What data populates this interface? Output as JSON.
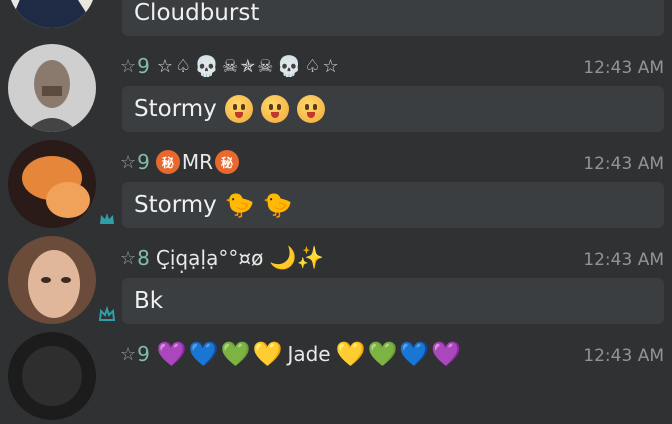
{
  "messages": [
    {
      "message": "Cloudburst"
    },
    {
      "level": "9",
      "username_symbols": [
        "☆",
        "♤",
        "💀",
        "☠",
        "✯",
        "☠",
        "💀",
        "♤",
        "☆"
      ],
      "time": "12:43 AM",
      "message": "Stormy",
      "message_emoji": [
        "😛",
        "😛",
        "😛"
      ]
    },
    {
      "level": "9",
      "username": "MR",
      "username_badge": "秘",
      "time": "12:43 AM",
      "message": "Stormy",
      "message_emoji": [
        "🐤",
        "🐤"
      ]
    },
    {
      "level": "8",
      "username": "Ç̣ịq̣ạḷạ°°¤ø",
      "username_emoji": [
        "🌙",
        "✨"
      ],
      "time": "12:43 AM",
      "message": "Bk"
    },
    {
      "level": "9",
      "username": "Jade",
      "username_hearts_left": [
        "💜",
        "💙",
        "💚",
        "💛"
      ],
      "username_hearts_right": [
        "💛",
        "💚",
        "💙",
        "💜"
      ],
      "time": "12:43 AM"
    }
  ],
  "colors": {
    "background": "#2f3133",
    "bubble": "#3b3e40",
    "level": "#7fbfa6",
    "time": "#8f9596",
    "crown": "#2e9ea8"
  },
  "icons": {
    "star": "star-outline-icon",
    "crown": "crown-icon"
  }
}
